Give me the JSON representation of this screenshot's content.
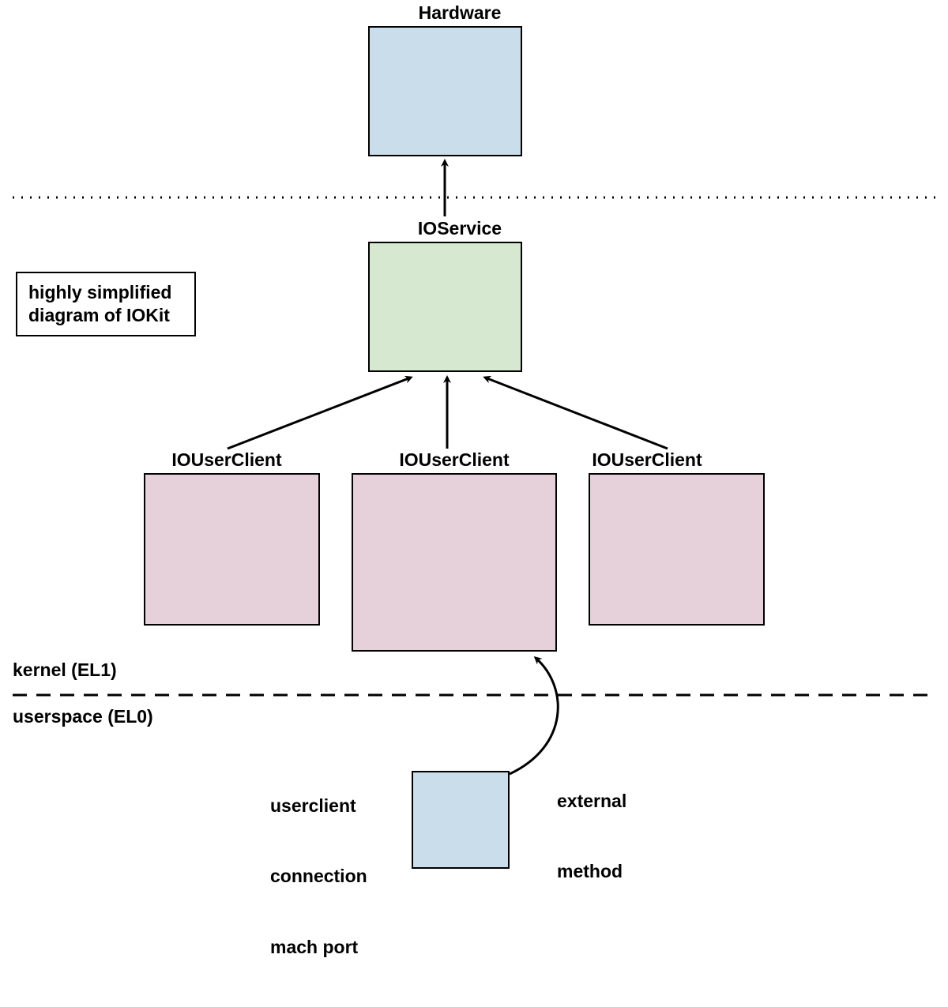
{
  "labels": {
    "hardware": "Hardware",
    "ioservice": "IOService",
    "iouserclient1": "IOUserClient",
    "iouserclient2": "IOUserClient",
    "iouserclient3": "IOUserClient",
    "kernel": "kernel (EL1)",
    "userspace": "userspace (EL0)",
    "note_line1": "highly simplified",
    "note_line2": "diagram of IOKit",
    "userclient_port_line1": "userclient",
    "userclient_port_line2": "connection",
    "userclient_port_line3": "mach port",
    "external_method_line1": "external",
    "external_method_line2": "method"
  },
  "colors": {
    "hardware_fill": "#c9ddea",
    "ioservice_fill": "#d6e8cf",
    "iouserclient_fill": "#e6d1da",
    "machport_fill": "#c9ddea",
    "border": "#000000"
  }
}
